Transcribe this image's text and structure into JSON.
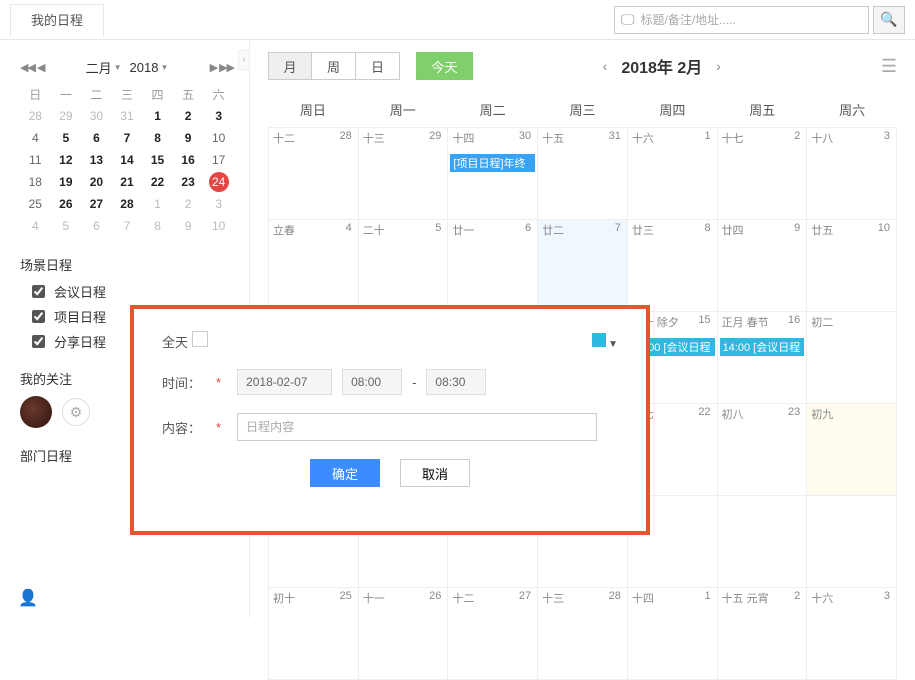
{
  "topbar": {
    "tab_label": "我的日程",
    "search_placeholder": "标题/备注/地址....."
  },
  "mini": {
    "nav_prev": "◀◀  ◀",
    "nav_next": "▶  ▶▶",
    "month_label": "二月",
    "year_label": "2018",
    "weekdays": [
      "日",
      "一",
      "二",
      "三",
      "四",
      "五",
      "六"
    ],
    "rows": [
      [
        {
          "n": "28",
          "dim": true
        },
        {
          "n": "29",
          "dim": true
        },
        {
          "n": "30",
          "dim": true
        },
        {
          "n": "31",
          "dim": true
        },
        {
          "n": "1",
          "bold": true
        },
        {
          "n": "2",
          "bold": true
        },
        {
          "n": "3",
          "bold": true
        }
      ],
      [
        {
          "n": "4"
        },
        {
          "n": "5",
          "bold": true
        },
        {
          "n": "6",
          "bold": true
        },
        {
          "n": "7",
          "bold": true
        },
        {
          "n": "8",
          "bold": true
        },
        {
          "n": "9",
          "bold": true
        },
        {
          "n": "10"
        }
      ],
      [
        {
          "n": "11"
        },
        {
          "n": "12",
          "bold": true
        },
        {
          "n": "13",
          "bold": true
        },
        {
          "n": "14",
          "bold": true
        },
        {
          "n": "15",
          "bold": true
        },
        {
          "n": "16",
          "bold": true
        },
        {
          "n": "17"
        }
      ],
      [
        {
          "n": "18"
        },
        {
          "n": "19",
          "bold": true
        },
        {
          "n": "20",
          "bold": true
        },
        {
          "n": "21",
          "bold": true
        },
        {
          "n": "22",
          "bold": true
        },
        {
          "n": "23",
          "bold": true
        },
        {
          "n": "24",
          "today": true
        }
      ],
      [
        {
          "n": "25"
        },
        {
          "n": "26",
          "bold": true
        },
        {
          "n": "27",
          "bold": true
        },
        {
          "n": "28",
          "bold": true
        },
        {
          "n": "1",
          "dim": true
        },
        {
          "n": "2",
          "dim": true
        },
        {
          "n": "3",
          "dim": true
        }
      ],
      [
        {
          "n": "4",
          "dim": true
        },
        {
          "n": "5",
          "dim": true
        },
        {
          "n": "6",
          "dim": true
        },
        {
          "n": "7",
          "dim": true
        },
        {
          "n": "8",
          "dim": true
        },
        {
          "n": "9",
          "dim": true
        },
        {
          "n": "10",
          "dim": true
        }
      ]
    ]
  },
  "side": {
    "scene_title": "场景日程",
    "scene_items": [
      "会议日程",
      "项目日程",
      "分享日程"
    ],
    "follow_title": "我的关注",
    "dept_title": "部门日程"
  },
  "tools": {
    "views": [
      "月",
      "周",
      "日"
    ],
    "today": "今天",
    "month_title": "2018年 2月"
  },
  "weekdays": [
    "周日",
    "周一",
    "周二",
    "周三",
    "周四",
    "周五",
    "周六"
  ],
  "cells": [
    [
      {
        "l": "十二",
        "d": "28"
      },
      {
        "l": "十三",
        "d": "29"
      },
      {
        "l": "十四",
        "d": "30",
        "ev": "[项目日程]年终",
        "evc": "blue"
      },
      {
        "l": "十五",
        "d": "31"
      },
      {
        "l": "十六",
        "d": "1"
      },
      {
        "l": "十七",
        "d": "2"
      },
      {
        "l": "十八",
        "d": "3"
      }
    ],
    [
      {
        "l": "立春",
        "d": "4"
      },
      {
        "l": "二十",
        "d": "5"
      },
      {
        "l": "廿一",
        "d": "6"
      },
      {
        "l": "廿二",
        "d": "7",
        "today": true
      },
      {
        "l": "廿三",
        "d": "8"
      },
      {
        "l": "廿四",
        "d": "9"
      },
      {
        "l": "廿五",
        "d": "10"
      }
    ],
    [
      {
        "l": "",
        "d": ""
      },
      {
        "l": "",
        "d": ""
      },
      {
        "l": "",
        "d": ""
      },
      {
        "l": "",
        "d": ""
      },
      {
        "l": "三十 除夕",
        "d": "15",
        "ev": "15:00 [会议日程",
        "evc": "cyan"
      },
      {
        "l": "正月 春节",
        "d": "16",
        "ev": "14:00 [会议日程",
        "evc": "cyan"
      },
      {
        "l": "初二",
        "d": ""
      }
    ],
    [
      {
        "l": "",
        "d": ""
      },
      {
        "l": "",
        "d": ""
      },
      {
        "l": "",
        "d": ""
      },
      {
        "l": "",
        "d": ""
      },
      {
        "l": "初七",
        "d": "22"
      },
      {
        "l": "初八",
        "d": "23"
      },
      {
        "l": "初九",
        "d": "",
        "hl": true
      }
    ],
    [
      {
        "l": "",
        "d": ""
      },
      {
        "l": "",
        "d": ""
      },
      {
        "l": "",
        "d": ""
      },
      {
        "l": "",
        "d": ""
      },
      {
        "l": "",
        "d": ""
      },
      {
        "l": "",
        "d": ""
      },
      {
        "l": "",
        "d": ""
      }
    ],
    [
      {
        "l": "初十",
        "d": "25"
      },
      {
        "l": "十一",
        "d": "26"
      },
      {
        "l": "十二",
        "d": "27"
      },
      {
        "l": "十三",
        "d": "28"
      },
      {
        "l": "十四",
        "d": "1"
      },
      {
        "l": "十五 元宵",
        "d": "2"
      },
      {
        "l": "十六",
        "d": "3"
      }
    ]
  ],
  "popup": {
    "allday_label": "全天",
    "time_label": "时间：",
    "date_value": "2018-02-07",
    "start_time": "08:00",
    "dash": "-",
    "end_time": "08:30",
    "content_label": "内容：",
    "content_placeholder": "日程内容",
    "ok": "确定",
    "cancel": "取消"
  }
}
